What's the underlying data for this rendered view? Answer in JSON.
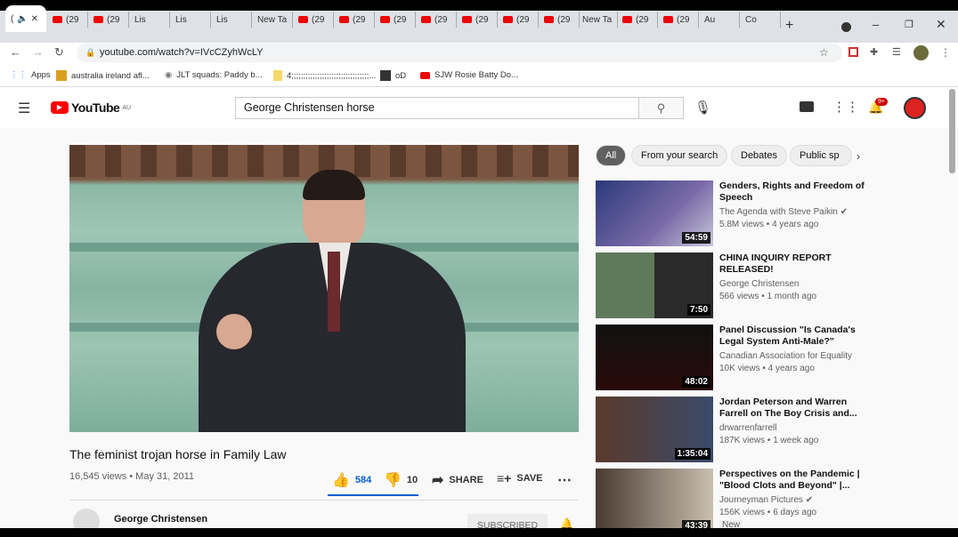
{
  "browser": {
    "tabs": [
      "(",
      "(29",
      "(29",
      "Lis",
      "Lis",
      "Lis",
      "New Ta",
      "(29",
      "(29",
      "(29",
      "(29",
      "(29",
      "(29",
      "(29",
      "New Ta",
      "(29",
      "(29",
      "Au",
      "Co"
    ],
    "url": "youtube.com/watch?v=IVcCZyhWcLY",
    "bookmarks": [
      "Apps",
      "australia ireland afl...",
      "JLT squads: Paddy b...",
      "4;;;;;;;;;;;;;;;;;;;;;;;;;;;;;;;;;...",
      "oD",
      "SJW Rosie Batty Do..."
    ]
  },
  "youtube": {
    "logo": "YouTube",
    "region": "AU",
    "search_value": "George Christensen horse",
    "notification_count": "9+",
    "chips": [
      "All",
      "From your search",
      "Debates",
      "Public sp"
    ],
    "video": {
      "title": "The feminist trojan horse in Family Law",
      "meta": "16,545 views • May 31, 2011",
      "likes": "584",
      "dislikes": "10",
      "share": "SHARE",
      "save": "SAVE",
      "channel": "George Christensen",
      "subscribe": "SUBSCRIBED"
    },
    "related": [
      {
        "title": "Genders, Rights and Freedom of Speech",
        "channel": "The Agenda with Steve Paikin",
        "verified": true,
        "meta": "5.8M views • 4 years ago",
        "duration": "54:59"
      },
      {
        "title": "CHINA INQUIRY REPORT RELEASED!",
        "channel": "George Christensen",
        "meta": "566 views • 1 month ago",
        "duration": "7:50"
      },
      {
        "title": "Panel Discussion \"Is Canada's Legal System Anti-Male?\"",
        "channel": "Canadian Association for Equality",
        "meta": "10K views • 4 years ago",
        "duration": "48:02"
      },
      {
        "title": "Jordan Peterson and Warren Farrell on The Boy Crisis and...",
        "channel": "drwarrenfarrell",
        "meta": "187K views • 1 week ago",
        "duration": "1:35:04"
      },
      {
        "title": "Perspectives on the Pandemic | \"Blood Clots and Beyond\" |...",
        "channel": "Journeyman Pictures",
        "verified": true,
        "meta": "156K views • 6 days ago",
        "duration": "43:39",
        "badge": "New"
      }
    ]
  }
}
